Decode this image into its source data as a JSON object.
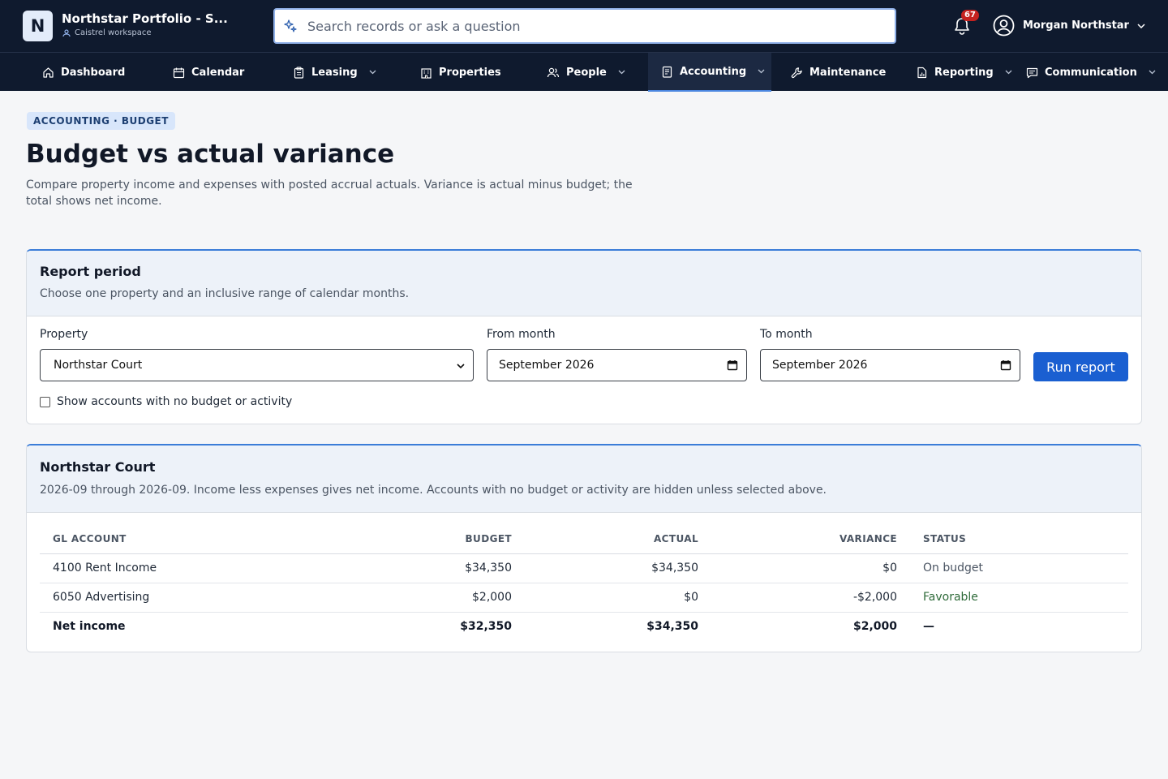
{
  "app": {
    "logo_letter": "N",
    "portfolio_name": "Northstar Portfolio - S...",
    "workspace": "Caistrel workspace"
  },
  "search": {
    "placeholder": "Search records or ask a question"
  },
  "notifications": {
    "count": "67"
  },
  "user": {
    "name": "Morgan Northstar"
  },
  "nav": {
    "items": [
      {
        "label": "Dashboard",
        "icon": "home-icon"
      },
      {
        "label": "Calendar",
        "icon": "calendar-icon"
      },
      {
        "label": "Leasing",
        "icon": "clipboard-icon",
        "dropdown": true
      },
      {
        "label": "Properties",
        "icon": "building-icon"
      },
      {
        "label": "People",
        "icon": "people-icon",
        "dropdown": true
      },
      {
        "label": "Accounting",
        "icon": "ledger-icon",
        "dropdown": true,
        "active": true
      },
      {
        "label": "Maintenance",
        "icon": "wrench-icon"
      },
      {
        "label": "Reporting",
        "icon": "report-icon",
        "dropdown": true
      },
      {
        "label": "Communication",
        "icon": "message-icon",
        "dropdown": true
      }
    ]
  },
  "page": {
    "breadcrumb": "ACCOUNTING · BUDGET",
    "title": "Budget vs actual variance",
    "subtitle": "Compare property income and expenses with posted accrual actuals. Variance is actual minus budget; the total shows net income."
  },
  "period": {
    "title": "Report period",
    "description": "Choose one property and an inclusive range of calendar months.",
    "property_label": "Property",
    "property_value": "Northstar Court",
    "from_label": "From month",
    "from_value": "September 2026",
    "to_label": "To month",
    "to_value": "September 2026",
    "run_label": "Run report",
    "show_empty_label": "Show accounts with no budget or activity",
    "show_empty_checked": false
  },
  "results": {
    "title": "Northstar Court",
    "description": "2026-09 through 2026-09. Income less expenses gives net income. Accounts with no budget or activity are hidden unless selected above.",
    "columns": [
      "GL ACCOUNT",
      "BUDGET",
      "ACTUAL",
      "VARIANCE",
      "STATUS"
    ],
    "rows": [
      {
        "account": "4100 Rent Income",
        "budget": "$34,350",
        "actual": "$34,350",
        "variance": "$0",
        "status": "On budget"
      },
      {
        "account": "6050 Advertising",
        "budget": "$2,000",
        "actual": "$0",
        "variance": "-$2,000",
        "status": "Favorable"
      }
    ],
    "total": {
      "account": "Net income",
      "budget": "$32,350",
      "actual": "$34,350",
      "variance": "$2,000",
      "status": "—"
    }
  },
  "colors": {
    "topbar": "#0f1a2e",
    "accent": "#1a5fd1",
    "favorable": "#2f6b3a",
    "badge": "#c5221f"
  }
}
